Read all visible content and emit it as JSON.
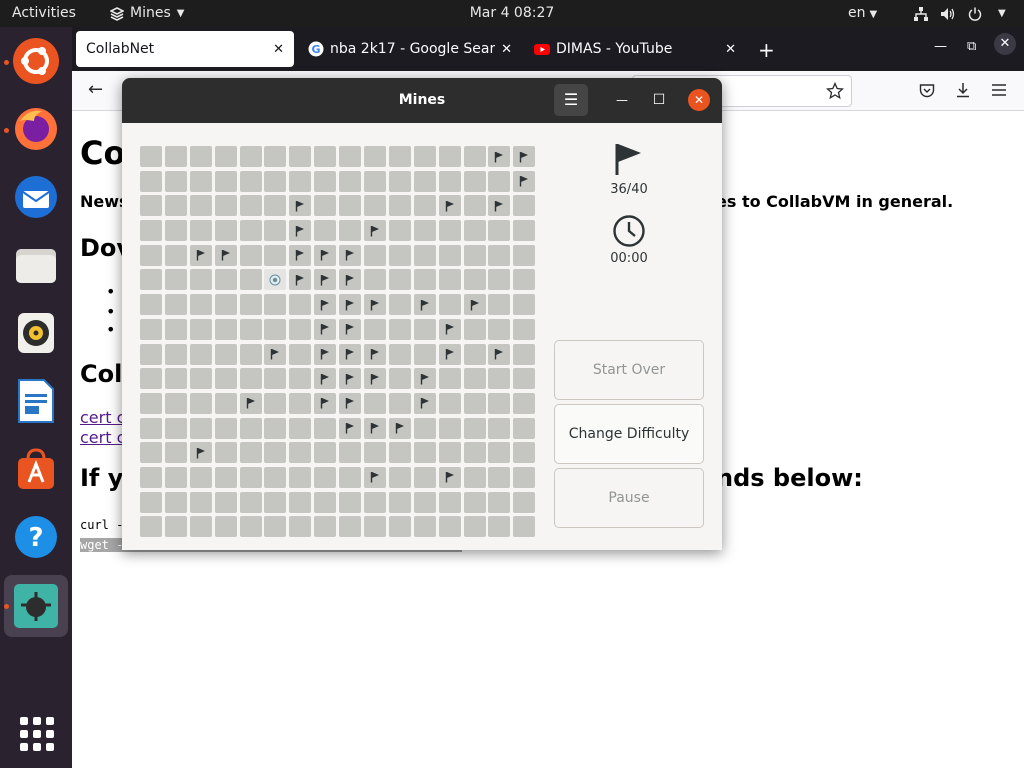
{
  "topbar": {
    "activities": "Activities",
    "app_name": "Mines",
    "clock": "Mar 4  08:27",
    "language": "en"
  },
  "browser": {
    "tabs": [
      {
        "title": "CollabNet",
        "active": true
      },
      {
        "title": "nba 2k17 - Google Search",
        "active": false
      },
      {
        "title": "DIMAS - YouTube",
        "active": false
      }
    ],
    "page": {
      "heading_visible": "Co",
      "news_left": "News",
      "news_right": "es to CollabVM in general.",
      "heading2_visible": "Dov",
      "heading3_visible": "Col",
      "link1_visible": "cert c",
      "link2_visible": "cert c",
      "heading4_left": "If y",
      "heading4_right": "nds below:",
      "code1_visible": "curl -",
      "code2_visible": "wget -"
    }
  },
  "mines": {
    "title": "Mines",
    "flag_count": "36/40",
    "time": "00:00",
    "buttons": {
      "start_over": "Start Over",
      "change_difficulty": "Change Difficulty",
      "pause": "Pause"
    },
    "rows": 16,
    "cols": 16,
    "flagged_cells": [
      [
        0,
        14
      ],
      [
        0,
        15
      ],
      [
        1,
        15
      ],
      [
        2,
        6
      ],
      [
        2,
        12
      ],
      [
        2,
        14
      ],
      [
        3,
        6
      ],
      [
        3,
        9
      ],
      [
        4,
        2
      ],
      [
        4,
        3
      ],
      [
        4,
        6
      ],
      [
        4,
        7
      ],
      [
        4,
        8
      ],
      [
        5,
        6
      ],
      [
        5,
        7
      ],
      [
        5,
        8
      ],
      [
        6,
        7
      ],
      [
        6,
        8
      ],
      [
        6,
        9
      ],
      [
        6,
        11
      ],
      [
        6,
        13
      ],
      [
        7,
        7
      ],
      [
        7,
        8
      ],
      [
        7,
        12
      ],
      [
        8,
        5
      ],
      [
        8,
        7
      ],
      [
        8,
        8
      ],
      [
        8,
        9
      ],
      [
        8,
        12
      ],
      [
        8,
        14
      ],
      [
        9,
        7
      ],
      [
        9,
        8
      ],
      [
        9,
        9
      ],
      [
        9,
        11
      ],
      [
        10,
        4
      ],
      [
        10,
        7
      ],
      [
        10,
        8
      ],
      [
        10,
        11
      ],
      [
        11,
        8
      ],
      [
        11,
        9
      ],
      [
        11,
        10
      ],
      [
        12,
        2
      ],
      [
        13,
        9
      ],
      [
        13,
        12
      ]
    ],
    "mine_shown_cells": [
      [
        5,
        5
      ]
    ]
  }
}
